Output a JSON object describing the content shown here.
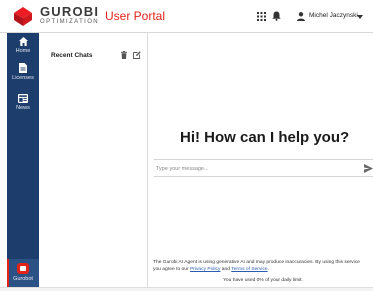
{
  "header": {
    "brand_name": "GUROBI",
    "brand_sub": "OPTIMIZATION",
    "portal_title": "User Portal",
    "user_name": "Michel Jaczynski",
    "icons": [
      "apps-icon",
      "bell-icon",
      "user-icon",
      "caret-down-icon"
    ]
  },
  "sidebar": {
    "items": [
      {
        "label": "Home",
        "icon": "home-icon"
      },
      {
        "label": "Licenses",
        "icon": "document-icon"
      },
      {
        "label": "News",
        "icon": "news-icon"
      }
    ],
    "bottom_item": {
      "label": "Gurobot",
      "icon": "robot-icon"
    }
  },
  "chats": {
    "title": "Recent Chats"
  },
  "main": {
    "greeting": "Hi! How can I help you?",
    "input_placeholder": "Type your message...",
    "disclaimer_line1": "The Gurobi AI Agent is using generative AI and may produce inaccuracies. By using this service",
    "disclaimer_line2_pre": "you agree to our ",
    "privacy_link": "Privacy Policy",
    "disclaimer_and": " and ",
    "terms_link": "Terms of Service",
    "disclaimer_end": ".",
    "usage_text": "You have used 0% of your daily limit."
  },
  "colors": {
    "brand_red": "#e2231a",
    "sidebar_blue": "#1d3d6c",
    "link_blue": "#2a5db0"
  }
}
